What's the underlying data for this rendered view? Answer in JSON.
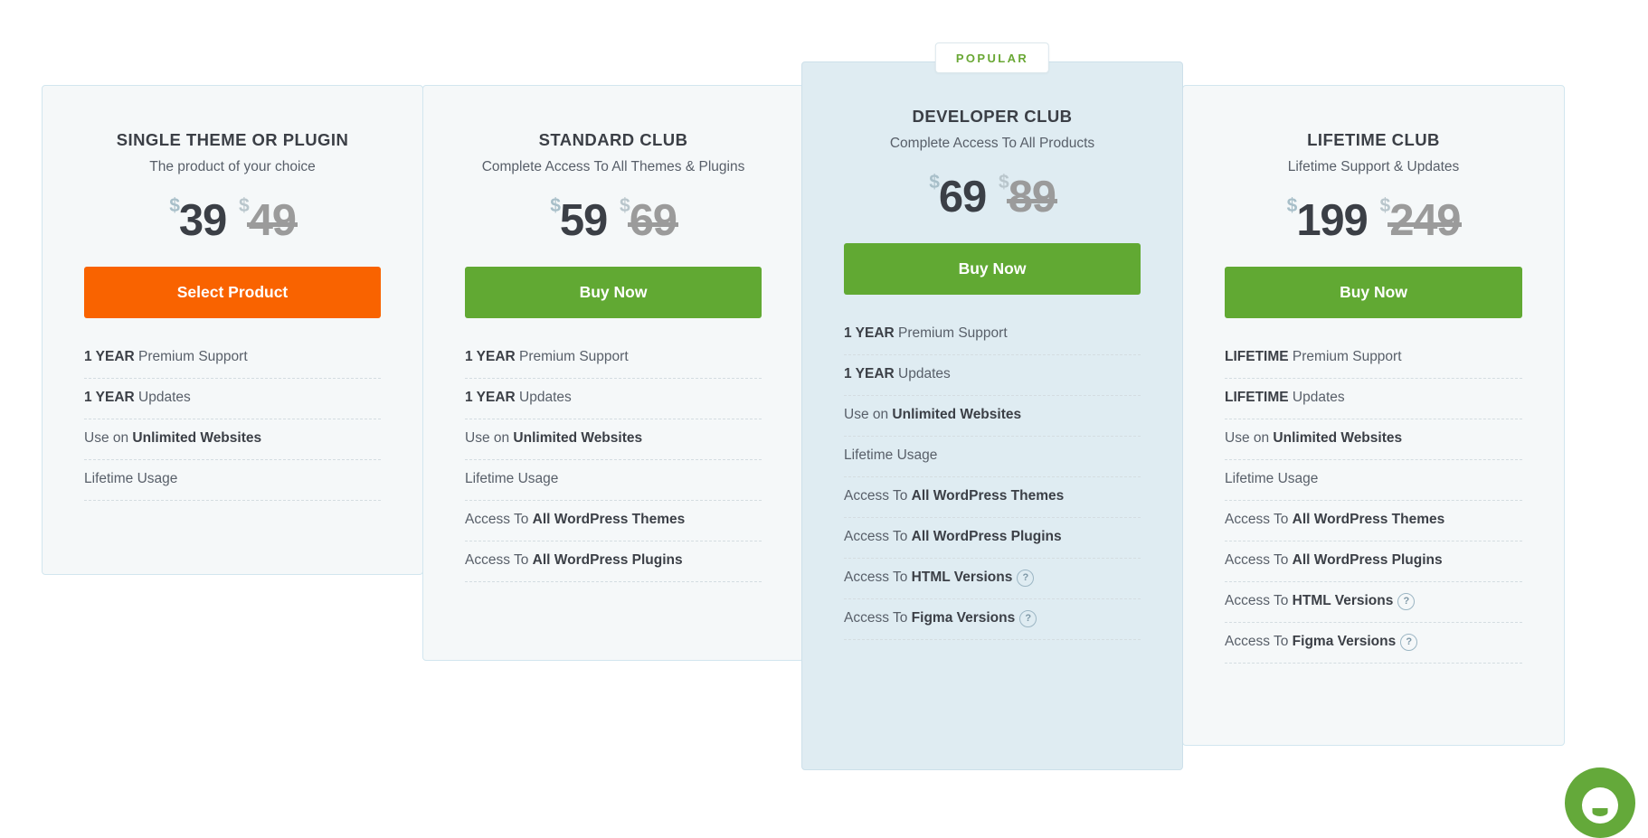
{
  "popular_badge": "POPULAR",
  "help_icon_glyph": "?",
  "colors": {
    "accent_green": "#61a933",
    "accent_orange": "#f96300",
    "card_bg": "#f5f8f9",
    "popular_card_bg": "#dfecf2",
    "card_border": "#d2e6ef",
    "badge_text": "#69a734",
    "price_current": "#3b3f46",
    "price_old": "#9b9b9b",
    "currency_symbol": "#a8bfc9"
  },
  "currency_symbol": "$",
  "chat_widget": {
    "name": "chat-widget",
    "icon": "chat-smiley-icon"
  },
  "plans": [
    {
      "title": "SINGLE THEME OR PLUGIN",
      "subtitle": "The product of your choice",
      "price": "39",
      "old_price": "49",
      "cta_label": "Select Product",
      "cta_style": "orange",
      "popular": false,
      "features": [
        {
          "strong": "1 YEAR",
          "text": " Premium Support",
          "strong_first": true,
          "help": false
        },
        {
          "strong": "1 YEAR",
          "text": " Updates",
          "strong_first": true,
          "help": false
        },
        {
          "strong": "Unlimited Websites",
          "text": "Use on ",
          "strong_first": false,
          "help": false
        },
        {
          "strong": "",
          "text": "Lifetime Usage",
          "strong_first": false,
          "help": false
        }
      ]
    },
    {
      "title": "STANDARD CLUB",
      "subtitle": "Complete Access To All Themes & Plugins",
      "price": "59",
      "old_price": "69",
      "cta_label": "Buy Now",
      "cta_style": "green",
      "popular": false,
      "features": [
        {
          "strong": "1 YEAR",
          "text": " Premium Support",
          "strong_first": true,
          "help": false
        },
        {
          "strong": "1 YEAR",
          "text": " Updates",
          "strong_first": true,
          "help": false
        },
        {
          "strong": "Unlimited Websites",
          "text": "Use on ",
          "strong_first": false,
          "help": false
        },
        {
          "strong": "",
          "text": "Lifetime Usage",
          "strong_first": false,
          "help": false
        },
        {
          "strong": "All WordPress Themes",
          "text": "Access To ",
          "strong_first": false,
          "help": false
        },
        {
          "strong": "All WordPress Plugins",
          "text": "Access To ",
          "strong_first": false,
          "help": false
        }
      ]
    },
    {
      "title": "DEVELOPER CLUB",
      "subtitle": "Complete Access To All Products",
      "price": "69",
      "old_price": "89",
      "cta_label": "Buy Now",
      "cta_style": "green",
      "popular": true,
      "features": [
        {
          "strong": "1 YEAR",
          "text": " Premium Support",
          "strong_first": true,
          "help": false
        },
        {
          "strong": "1 YEAR",
          "text": " Updates",
          "strong_first": true,
          "help": false
        },
        {
          "strong": "Unlimited Websites",
          "text": "Use on ",
          "strong_first": false,
          "help": false
        },
        {
          "strong": "",
          "text": "Lifetime Usage",
          "strong_first": false,
          "help": false
        },
        {
          "strong": "All WordPress Themes",
          "text": "Access To ",
          "strong_first": false,
          "help": false
        },
        {
          "strong": "All WordPress Plugins",
          "text": "Access To ",
          "strong_first": false,
          "help": false
        },
        {
          "strong": "HTML Versions",
          "text": "Access To ",
          "strong_first": false,
          "help": true
        },
        {
          "strong": "Figma Versions",
          "text": "Access To ",
          "strong_first": false,
          "help": true
        }
      ]
    },
    {
      "title": "LIFETIME CLUB",
      "subtitle": "Lifetime Support & Updates",
      "price": "199",
      "old_price": "249",
      "cta_label": "Buy Now",
      "cta_style": "green",
      "popular": false,
      "features": [
        {
          "strong": "LIFETIME",
          "text": " Premium Support",
          "strong_first": true,
          "help": false
        },
        {
          "strong": "LIFETIME",
          "text": " Updates",
          "strong_first": true,
          "help": false
        },
        {
          "strong": "Unlimited Websites",
          "text": "Use on ",
          "strong_first": false,
          "help": false
        },
        {
          "strong": "",
          "text": "Lifetime Usage",
          "strong_first": false,
          "help": false
        },
        {
          "strong": "All WordPress Themes",
          "text": "Access To ",
          "strong_first": false,
          "help": false
        },
        {
          "strong": "All WordPress Plugins",
          "text": "Access To ",
          "strong_first": false,
          "help": false
        },
        {
          "strong": "HTML Versions",
          "text": "Access To ",
          "strong_first": false,
          "help": true
        },
        {
          "strong": "Figma Versions",
          "text": "Access To ",
          "strong_first": false,
          "help": true
        }
      ]
    }
  ]
}
